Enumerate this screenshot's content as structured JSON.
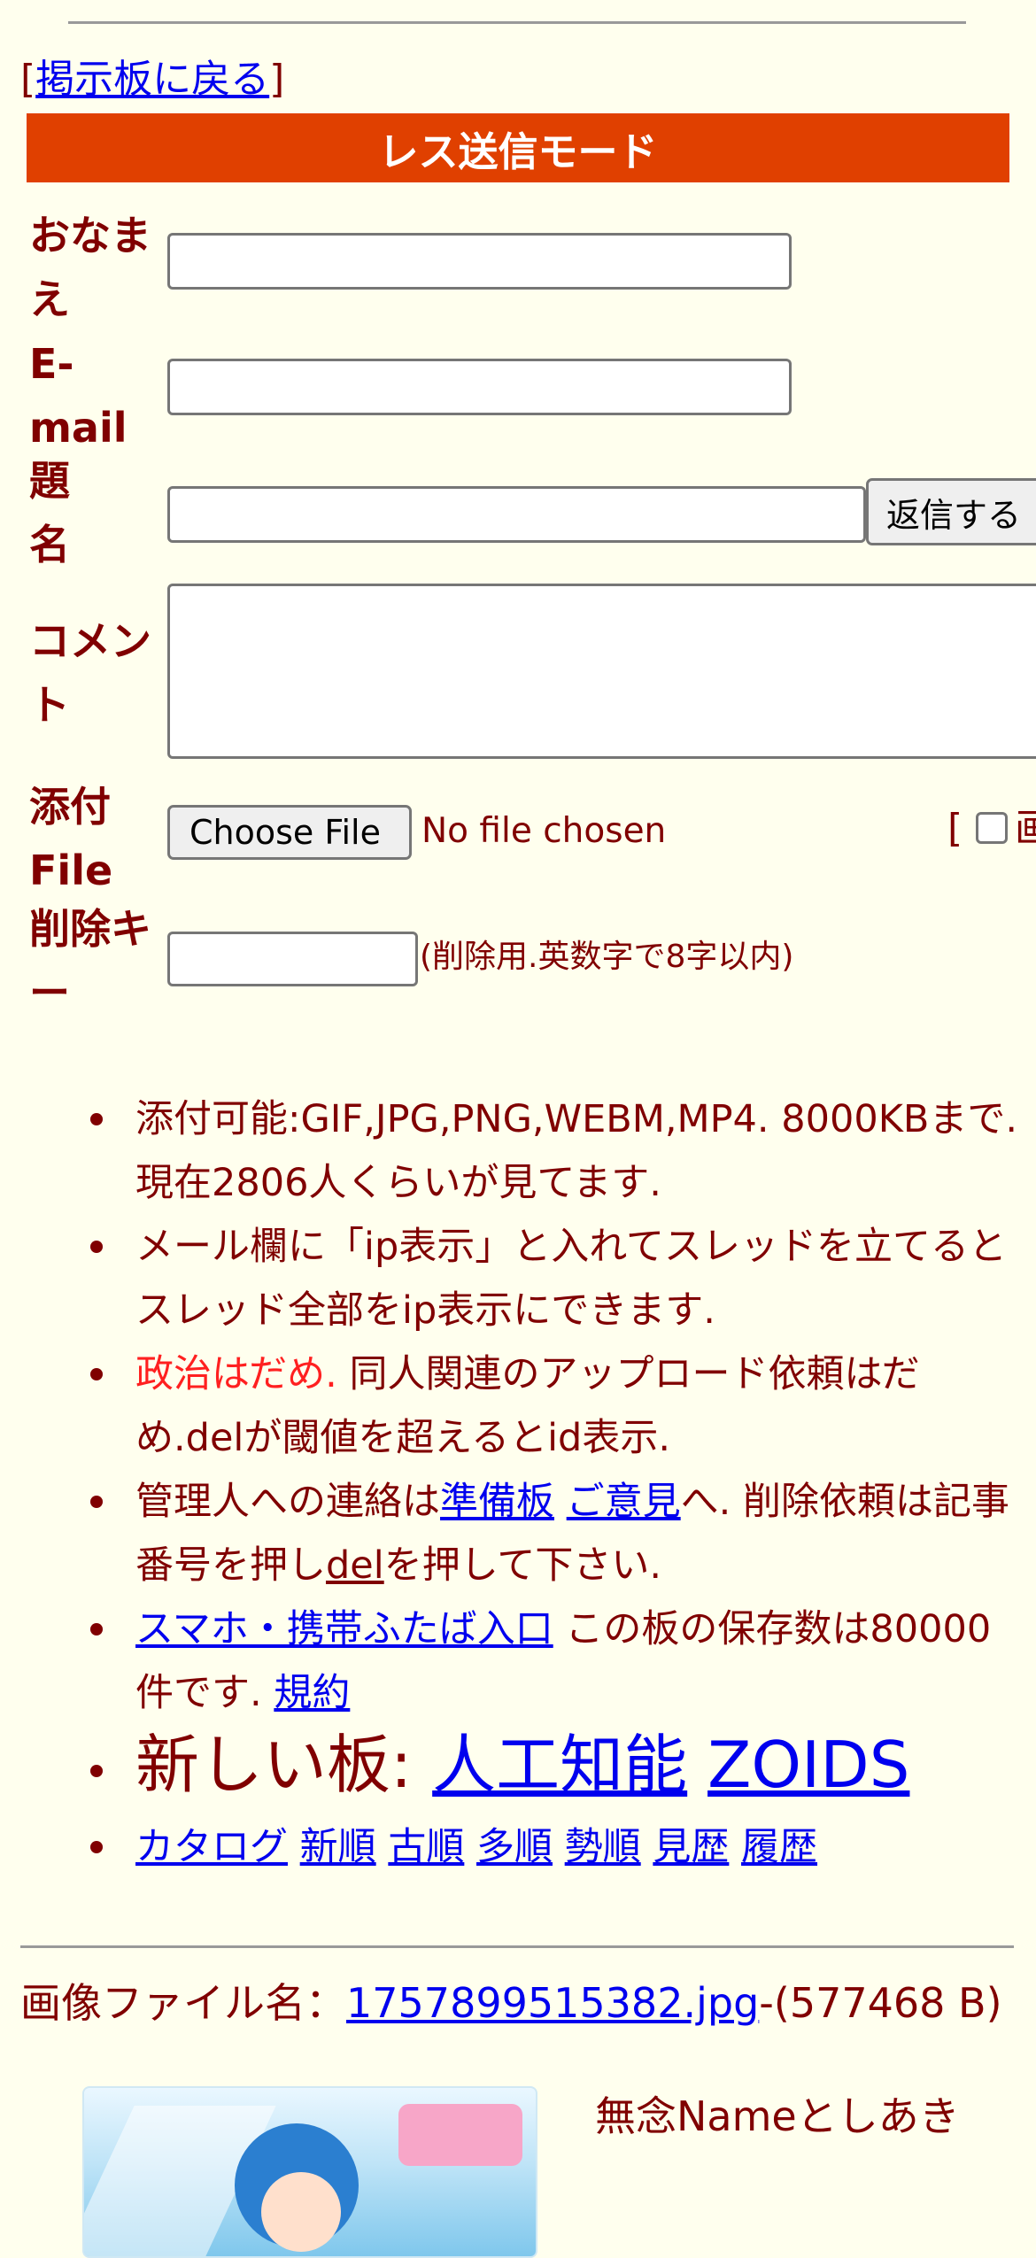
{
  "back_link": {
    "open": "[",
    "label": "掲示板に戻る",
    "close": "]"
  },
  "banner": {
    "title": "レス送信モード"
  },
  "form": {
    "name_label": "おなまえ",
    "email_label": "E-mail",
    "subject_label": "題名",
    "comment_label": "コメント",
    "file_label": "添付File",
    "delete_key_label": "削除キー",
    "submit_label": "返信する",
    "choose_file_label": "Choose File",
    "no_file_text": "No file chosen",
    "file_extra_open": "[",
    "file_extra_cut_char": "画",
    "delete_key_hint": "(削除用.英数字で8字以内)"
  },
  "notes": {
    "n1": "添付可能:GIF,JPG,PNG,WEBM,MP4. 8000KBまで. 現在2806人くらいが見てます.",
    "n2": "メール欄に「ip表示」と入れてスレッドを立てるとスレッド全部をip表示にできます.",
    "n3_red": "政治はだめ.",
    "n3_rest": " 同人関連のアップロード依頼はだめ.delが閾値を超えるとid表示.",
    "n4_pre": "管理人への連絡は",
    "n4_link1": "準備板",
    "n4_link2": "ご意見",
    "n4_mid": "へ. 削除依頼は記事番号を押し",
    "n4_link3": "del",
    "n4_post": "を押して下さい.",
    "n5_link": "スマホ・携帯ふたば入口",
    "n5_mid": " この板の保存数は80000件です. ",
    "n5_link2": "規約",
    "n6_prefix": "新しい板: ",
    "n6_link1": "人工知能",
    "n6_link2": "ZOIDS",
    "nav_links": [
      "カタログ",
      "新順",
      "古順",
      "多順",
      "勢順",
      "見歴",
      "履歴"
    ]
  },
  "post": {
    "file_label": "画像ファイル名：",
    "file_name": "1757899515382.jpg",
    "file_size": "-(577468 B)",
    "name_text": "無念Nameとしあき"
  }
}
